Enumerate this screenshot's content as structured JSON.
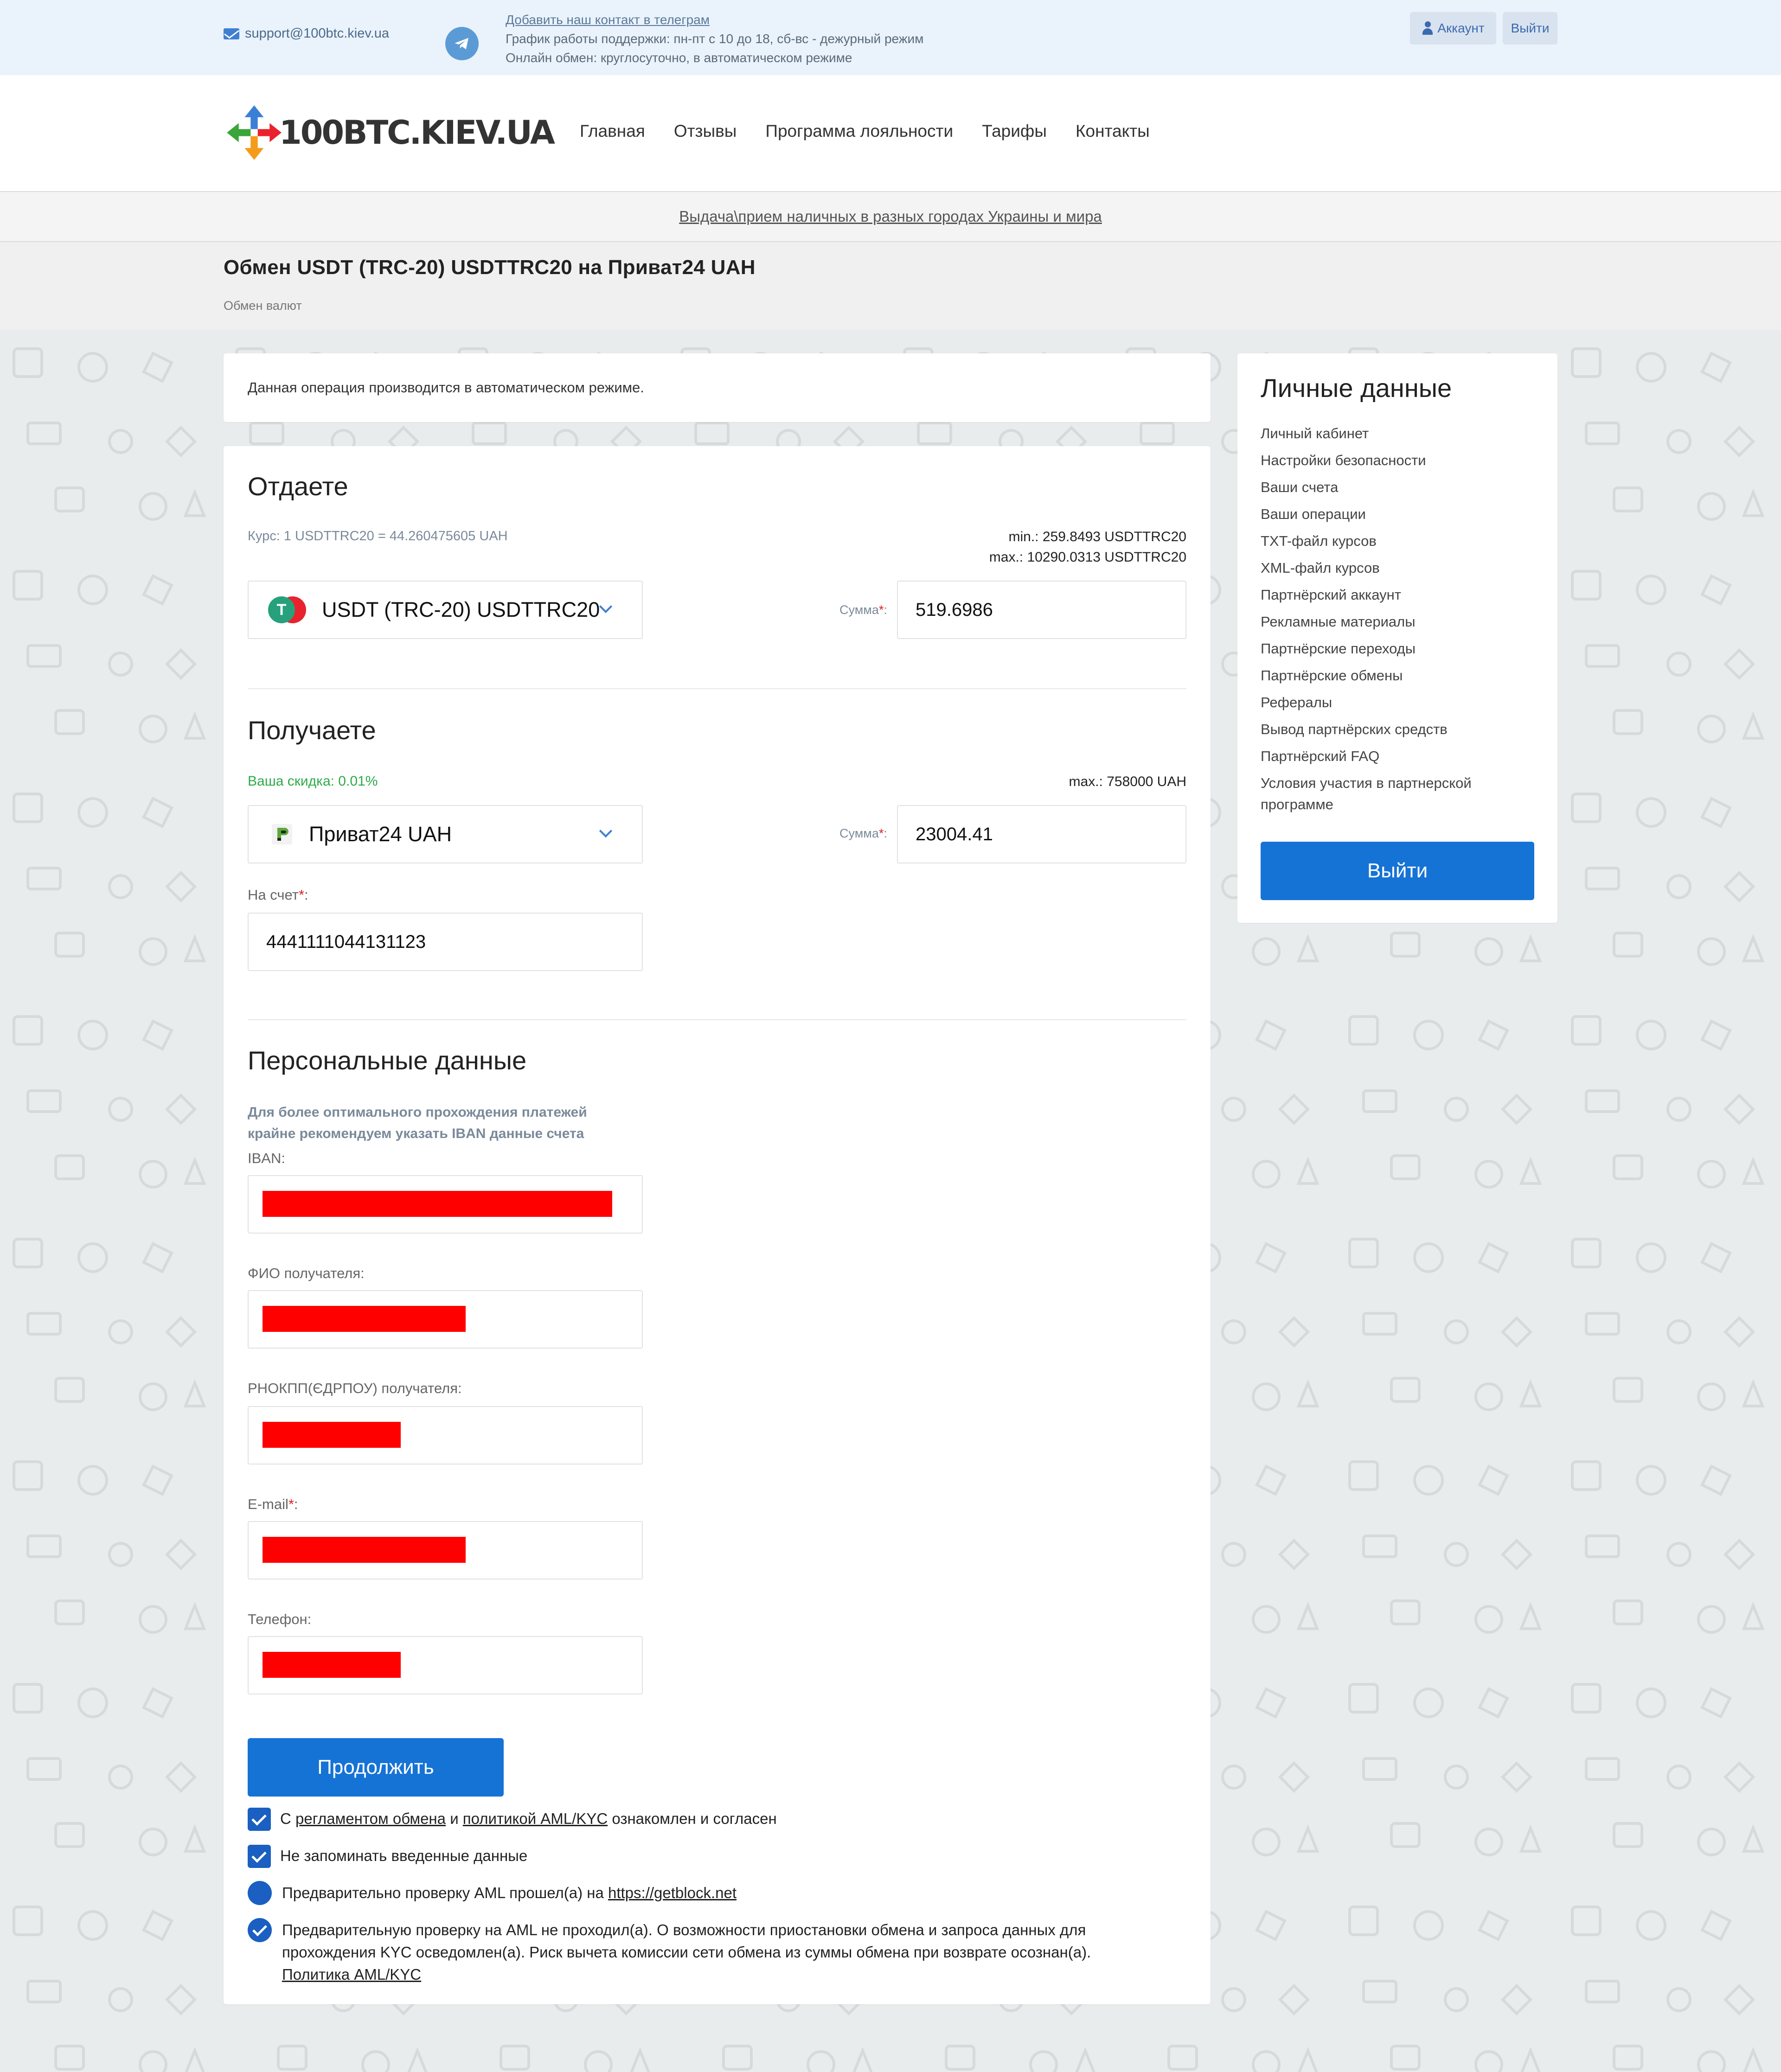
{
  "topbar": {
    "email": "support@100btc.kiev.ua",
    "telegram_link": "Добавить наш контакт в телеграм",
    "schedule": "График работы поддержки: пн-пт с 10 до 18, сб-вс - дежурный режим",
    "online": "Онлайн обмен: круглосуточно, в автоматическом режиме",
    "account_label": "Аккаунт",
    "logout_label": "Выйти"
  },
  "header": {
    "logo_text": "100BTC.KIEV.UA",
    "nav": [
      "Главная",
      "Отзывы",
      "Программа лояльности",
      "Тарифы",
      "Контакты"
    ]
  },
  "banner": {
    "text": "Выдача\\прием наличных в разных городах Украины и мира"
  },
  "page": {
    "title": "Обмен USDT (TRC-20) USDTTRC20 на Приват24 UAH",
    "breadcrumb": "Обмен валют"
  },
  "notice": {
    "text": "Данная операция производится в автоматическом режиме."
  },
  "give": {
    "title": "Отдаете",
    "rate": "Курс: 1 USDTTRC20 = 44.260475605 UAH",
    "min": "min.: 259.8493 USDTTRC20",
    "max": "max.: 10290.0313 USDTTRC20",
    "currency": "USDT (TRC-20) USDTTRC20",
    "sum_label": "Сумма",
    "sum_value": "519.6986"
  },
  "get": {
    "title": "Получаете",
    "discount": "Ваша скидка: 0.01%",
    "max": "max.: 758000 UAH",
    "currency": "Приват24 UAH",
    "sum_label": "Сумма",
    "sum_value": "23004.41",
    "account_label": "На счет",
    "account_value": "4441111044131123"
  },
  "personal": {
    "title": "Персональные данные",
    "hint_line1": "Для более оптимального прохождения платежей",
    "hint_line2": "крайне рекомендуем указать IBAN данные счета",
    "iban_label": "IBAN:",
    "fio_label": "ФИО получателя:",
    "inn_label": "РНОКПП(ЄДРПОУ) получателя:",
    "email_label": "E-mail",
    "phone_label": "Телефон:"
  },
  "actions": {
    "continue_label": "Продолжить",
    "agree_prefix": "С",
    "agree_link1": "регламентом обмена",
    "agree_and": "и",
    "agree_link2": "политикой AML/KYC",
    "agree_suffix": "ознакомлен и согласен",
    "no_remember": "Не запоминать введенные данные",
    "aml_passed_prefix": "Предварительно проверку AML прошел(а) на",
    "aml_passed_link": "https://getblock.net",
    "aml_not_line1": "Предварительную проверку на AML не проходил(а). О возможности приостановки обмена и запроса данных для",
    "aml_not_line2": "прохождения KYC осведомлен(а). Риск вычета комиссии сети обмена из суммы обмена при возврате осознан(а).",
    "aml_policy_link": "Политика AML/KYC"
  },
  "sidebar": {
    "title": "Личные данные",
    "items": [
      "Личный кабинет",
      "Настройки безопасности",
      "Ваши счета",
      "Ваши операции",
      "TXT-файл курсов",
      "XML-файл курсов",
      "Партнёрский аккаунт",
      "Рекламные материалы",
      "Партнёрские переходы",
      "Партнёрские обмены",
      "Рефералы",
      "Вывод партнёрских средств",
      "Партнёрский FAQ",
      "Условия участия в партнерской программе"
    ],
    "logout_label": "Выйти"
  },
  "colors": {
    "accent": "#1673d6",
    "checkbox": "#1a5fc1",
    "discount": "#2eaa4a",
    "redaction": "#ff0000",
    "topbar_bg": "#eaf2fb"
  },
  "icons": [
    "mail-icon",
    "telegram-icon",
    "user-icon",
    "usdt-coin-icon",
    "privat24-icon",
    "chevron-down-icon",
    "checkbox-icon",
    "radio-icon"
  ]
}
